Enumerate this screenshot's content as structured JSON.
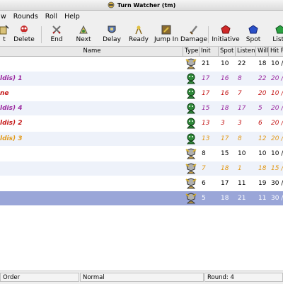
{
  "window": {
    "title": "Turn Watcher (tm)"
  },
  "menu": [
    "w",
    "Rounds",
    "Roll",
    "Help"
  ],
  "toolbar": [
    {
      "label": "t",
      "icon": "add-icon"
    },
    {
      "label": "Delete",
      "icon": "delete-icon"
    },
    {
      "label": "End",
      "icon": "swords-icon"
    },
    {
      "label": "Next",
      "icon": "next-turn-icon"
    },
    {
      "label": "Delay",
      "icon": "shield-delay-icon"
    },
    {
      "label": "Ready",
      "icon": "ready-icon"
    },
    {
      "label": "Jump In",
      "icon": "jump-in-icon"
    },
    {
      "label": "Damage",
      "icon": "damage-icon"
    },
    {
      "label": "Initiative",
      "icon": "initiative-die-icon"
    },
    {
      "label": "Spot",
      "icon": "spot-die-icon"
    },
    {
      "label": "Liste",
      "icon": "listen-die-icon"
    }
  ],
  "columns": [
    "Name",
    "Type",
    "Init",
    "Spot",
    "Listen",
    "Will",
    "Hit P"
  ],
  "rows": [
    {
      "name": "",
      "type": "player",
      "init": "21",
      "spot": "10",
      "listen": "22",
      "will": "18",
      "hp": "10 /",
      "style": "plain"
    },
    {
      "name": "ldis) 1",
      "type": "monster",
      "init": "17",
      "spot": "16",
      "listen": "8",
      "will": "22",
      "hp": "20 /",
      "style": "purple"
    },
    {
      "name": "ne",
      "type": "monster",
      "init": "17",
      "spot": "16",
      "listen": "7",
      "will": "20",
      "hp": "10 /",
      "style": "red"
    },
    {
      "name": "ldis) 4",
      "type": "monster",
      "init": "15",
      "spot": "18",
      "listen": "17",
      "will": "5",
      "hp": "20 /",
      "style": "purple"
    },
    {
      "name": "ldis) 2",
      "type": "monster",
      "init": "13",
      "spot": "3",
      "listen": "3",
      "will": "6",
      "hp": "20 /",
      "style": "red"
    },
    {
      "name": "ldis) 3",
      "type": "monster",
      "init": "13",
      "spot": "17",
      "listen": "8",
      "will": "12",
      "hp": "20 /",
      "style": "orange"
    },
    {
      "name": "",
      "type": "player",
      "init": "8",
      "spot": "15",
      "listen": "10",
      "will": "10",
      "hp": "10 /",
      "style": "plain"
    },
    {
      "name": "",
      "type": "player",
      "init": "7",
      "spot": "18",
      "listen": "1",
      "will": "18",
      "hp": "15 /",
      "style": "orange"
    },
    {
      "name": "",
      "type": "player",
      "init": "6",
      "spot": "17",
      "listen": "11",
      "will": "19",
      "hp": "30 /",
      "style": "plain"
    },
    {
      "name": "",
      "type": "player",
      "init": "5",
      "spot": "18",
      "listen": "21",
      "will": "11",
      "hp": "30 /",
      "style": "selected"
    }
  ],
  "status": {
    "left": "Order",
    "middle": "Normal",
    "right": "Round: 4"
  }
}
